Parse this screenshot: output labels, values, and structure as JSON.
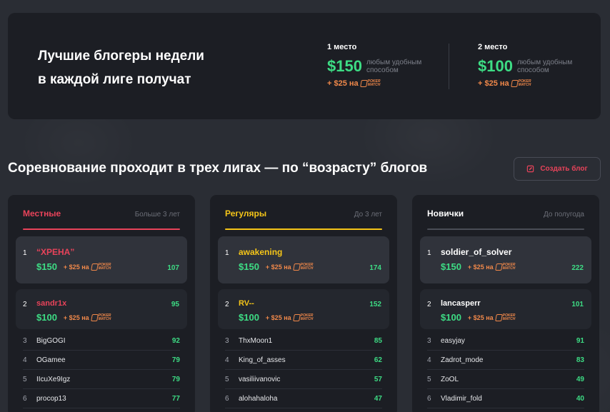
{
  "hero": {
    "title_line1": "Лучшие блогеры недели",
    "title_line2": "в каждой лиге получат",
    "prizes": [
      {
        "place": "1 место",
        "amount": "$150",
        "desc": "любым удобным способом",
        "bonus": "+ $25 на"
      },
      {
        "place": "2 место",
        "amount": "$100",
        "desc": "любым удобным способом",
        "bonus": "+ $25 на"
      }
    ],
    "logo_text_1": "POKER",
    "logo_text_2": "MATCH"
  },
  "section": {
    "title": "Соревнование проходит в трех лигах — по “возрасту” блогов",
    "create_button": "Создать блог"
  },
  "colors": {
    "green": "#3ddc84",
    "orange": "#f0884a",
    "red": "#e8435a",
    "yellow": "#f5c518",
    "white": "#ffffff"
  },
  "leagues": [
    {
      "name": "Местные",
      "age": "Больше 3 лет",
      "accent": "#e8435a",
      "top": [
        {
          "rank": "1",
          "name": "“ХРЕНА”",
          "amount": "$150",
          "bonus": "+ $25 на",
          "score": "107"
        },
        {
          "rank": "2",
          "name": "sandr1x",
          "amount": "$100",
          "bonus": "+ $25 на",
          "score": "95"
        }
      ],
      "rows": [
        {
          "rank": "3",
          "name": "BigGOGI",
          "score": "92"
        },
        {
          "rank": "4",
          "name": "OGamee",
          "score": "79"
        },
        {
          "rank": "5",
          "name": "IIcuXe9Igz",
          "score": "79"
        },
        {
          "rank": "6",
          "name": "procop13",
          "score": "77"
        }
      ]
    },
    {
      "name": "Регуляры",
      "age": "До 3 лет",
      "accent": "#f5c518",
      "top": [
        {
          "rank": "1",
          "name": "awakening",
          "amount": "$150",
          "bonus": "+ $25 на",
          "score": "174"
        },
        {
          "rank": "2",
          "name": "RV--",
          "amount": "$100",
          "bonus": "+ $25 на",
          "score": "152"
        }
      ],
      "rows": [
        {
          "rank": "3",
          "name": "ThxMoon1",
          "score": "85"
        },
        {
          "rank": "4",
          "name": "King_of_asses",
          "score": "62"
        },
        {
          "rank": "5",
          "name": "vasiliivanovic",
          "score": "57"
        },
        {
          "rank": "6",
          "name": "alohahaloha",
          "score": "47"
        }
      ]
    },
    {
      "name": "Новички",
      "age": "До полугода",
      "accent": "#ffffff",
      "top": [
        {
          "rank": "1",
          "name": "soldier_of_solver",
          "amount": "$150",
          "bonus": "+ $25 на",
          "score": "222"
        },
        {
          "rank": "2",
          "name": "lancasperr",
          "amount": "$100",
          "bonus": "+ $25 на",
          "score": "101"
        }
      ],
      "rows": [
        {
          "rank": "3",
          "name": "easyjay",
          "score": "91"
        },
        {
          "rank": "4",
          "name": "Zadrot_mode",
          "score": "83"
        },
        {
          "rank": "5",
          "name": "ZoOL",
          "score": "49"
        },
        {
          "rank": "6",
          "name": "Vladimir_fold",
          "score": "40"
        }
      ]
    }
  ]
}
